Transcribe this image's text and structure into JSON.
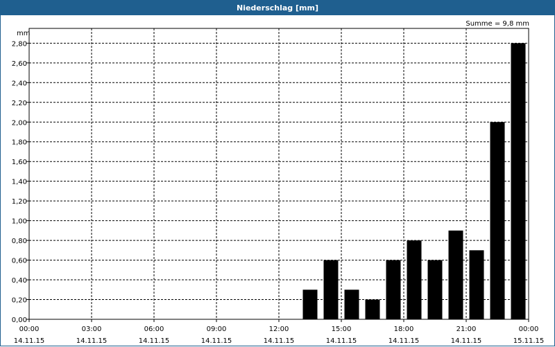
{
  "window": {
    "title": "Niederschlag [mm]"
  },
  "chart_data": {
    "type": "bar",
    "title": "Niederschlag [mm]",
    "ylabel": "mm",
    "annotation": "Summe = 9,8 mm",
    "ylim": [
      0,
      2.95
    ],
    "y_ticks": [
      0,
      0.2,
      0.4,
      0.6,
      0.8,
      1.0,
      1.2,
      1.4,
      1.6,
      1.8,
      2.0,
      2.2,
      2.4,
      2.6,
      2.8
    ],
    "y_tick_labels": [
      "0,00",
      "0,20",
      "0,40",
      "0,60",
      "0,80",
      "1,00",
      "1,20",
      "1,40",
      "1,60",
      "1,80",
      "2,00",
      "2,20",
      "2,40",
      "2,60",
      "2,80"
    ],
    "x_range_hours": [
      0,
      24
    ],
    "x_ticks": [
      {
        "time": "00:00",
        "date": "14.11.15"
      },
      {
        "time": "03:00",
        "date": "14.11.15"
      },
      {
        "time": "06:00",
        "date": "14.11.15"
      },
      {
        "time": "09:00",
        "date": "14.11.15"
      },
      {
        "time": "12:00",
        "date": "14.11.15"
      },
      {
        "time": "15:00",
        "date": "14.11.15"
      },
      {
        "time": "18:00",
        "date": "14.11.15"
      },
      {
        "time": "21:00",
        "date": "14.11.15"
      },
      {
        "time": "00:00",
        "date": "15.11.15"
      }
    ],
    "grid": true,
    "bar_color": "#000000",
    "bars": [
      {
        "start": "13:00",
        "end": "14:00",
        "value": 0.3
      },
      {
        "start": "14:00",
        "end": "15:00",
        "value": 0.6
      },
      {
        "start": "15:00",
        "end": "16:00",
        "value": 0.3
      },
      {
        "start": "16:00",
        "end": "17:00",
        "value": 0.2
      },
      {
        "start": "17:00",
        "end": "18:00",
        "value": 0.6
      },
      {
        "start": "18:00",
        "end": "19:00",
        "value": 0.8
      },
      {
        "start": "19:00",
        "end": "20:00",
        "value": 0.6
      },
      {
        "start": "20:00",
        "end": "21:00",
        "value": 0.9
      },
      {
        "start": "21:00",
        "end": "22:00",
        "value": 0.7
      },
      {
        "start": "22:00",
        "end": "23:00",
        "value": 2.0
      },
      {
        "start": "23:00",
        "end": "00:00",
        "value": 2.8
      }
    ]
  }
}
